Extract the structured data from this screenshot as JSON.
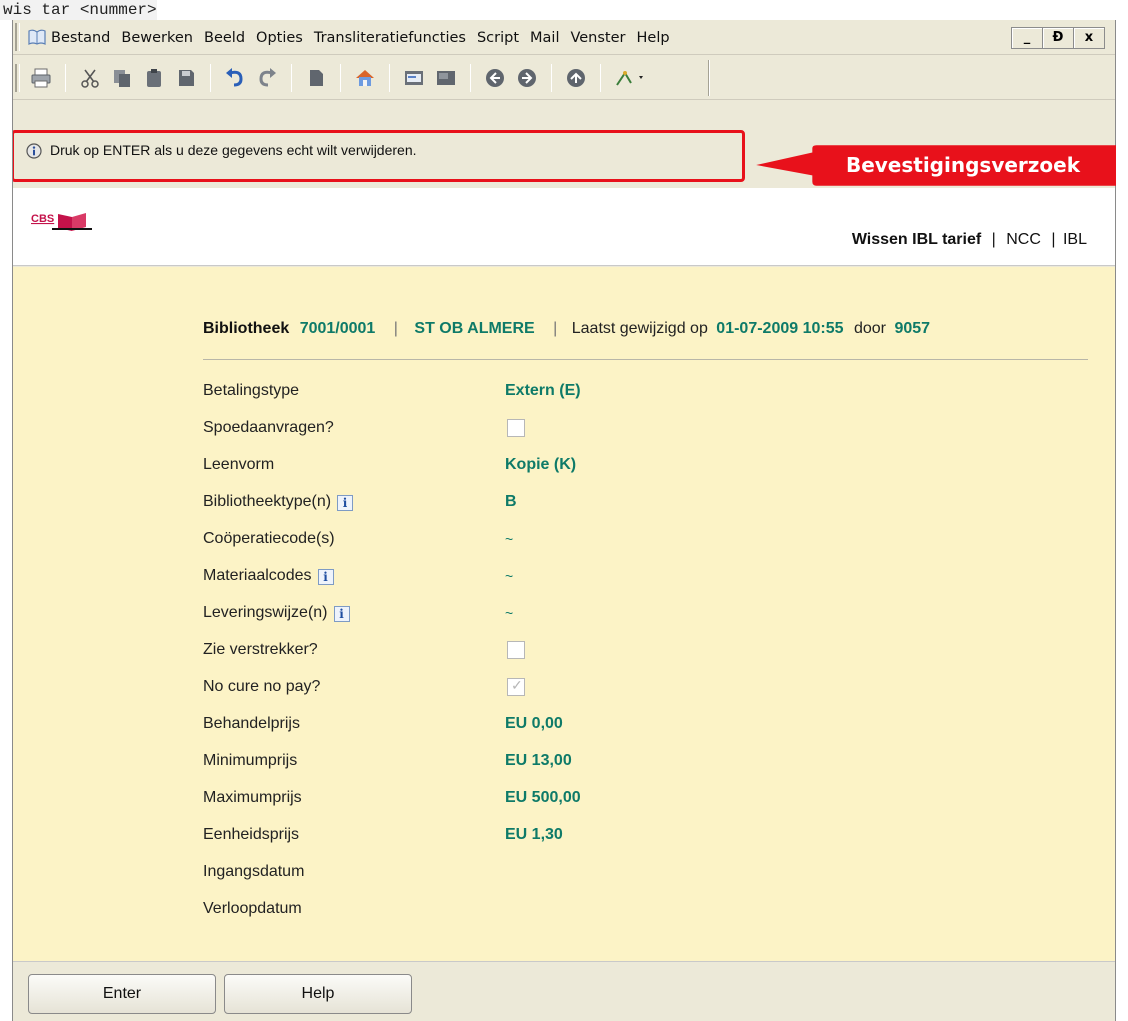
{
  "command_line": "wis tar <nummer>",
  "menubar": {
    "items": [
      "Bestand",
      "Bewerken",
      "Beeld",
      "Opties",
      "Transliteratiefuncties",
      "Script",
      "Mail",
      "Venster",
      "Help"
    ],
    "window_controls": [
      "_",
      "Ɖ",
      "x"
    ]
  },
  "toolbar": {
    "icons": [
      "print-icon",
      "cut-icon",
      "copy-icon",
      "paste-icon",
      "save-icon",
      "undo-icon",
      "redo-icon",
      "page-icon",
      "home-icon",
      "form-icon",
      "card-icon",
      "back-icon",
      "forward-icon",
      "up-icon",
      "tools-icon"
    ]
  },
  "message": {
    "text": "Druk op ENTER als u deze gegevens echt wilt verwijderen."
  },
  "callout": {
    "text": "Bevestigingsverzoek"
  },
  "header": {
    "logo_text": "CBS",
    "title": "Wissen IBL tarief",
    "sep1": "|",
    "tag1": "NCC",
    "sep2": "|",
    "tag2": "IBL"
  },
  "infobar": {
    "library_label": "Bibliotheek",
    "library_code": "7001/0001",
    "separator": "|",
    "library_name": "ST OB ALMERE",
    "modified_label": "Laatst gewijzigd op",
    "modified_date": "01-07-2009 10:55",
    "by_label": "door",
    "by_user": "9057"
  },
  "fields": {
    "betalingstype": {
      "label": "Betalingstype",
      "value": "Extern (E)"
    },
    "spoedaanvragen": {
      "label": "Spoedaanvragen?",
      "checked": false
    },
    "leenvorm": {
      "label": "Leenvorm",
      "value": "Kopie (K)"
    },
    "bibliotheektype": {
      "label": "Bibliotheektype(n)",
      "value": "B"
    },
    "cooperatiecode": {
      "label": "Coöperatiecode(s)",
      "value": "~"
    },
    "materiaalcodes": {
      "label": "Materiaalcodes",
      "value": "~"
    },
    "leveringswijze": {
      "label": "Leveringswijze(n)",
      "value": "~"
    },
    "zie_verstrekker": {
      "label": "Zie verstrekker?",
      "checked": false
    },
    "no_cure_no_pay": {
      "label": "No cure no pay?",
      "checked": true
    },
    "behandelprijs": {
      "label": "Behandelprijs",
      "value": "EU 0,00"
    },
    "minimumprijs": {
      "label": "Minimumprijs",
      "value": "EU 13,00"
    },
    "maximumprijs": {
      "label": "Maximumprijs",
      "value": "EU 500,00"
    },
    "eenheidsprijs": {
      "label": "Eenheidsprijs",
      "value": "EU 1,30"
    },
    "ingangsdatum": {
      "label": "Ingangsdatum",
      "value": ""
    },
    "verloopdatum": {
      "label": "Verloopdatum",
      "value": ""
    }
  },
  "info_icon_glyph": "i",
  "buttons": {
    "enter": "Enter",
    "help": "Help"
  },
  "colors": {
    "value_green": "#0e7a68",
    "highlight_red": "#e8111b",
    "content_bg": "#fcf3c6"
  }
}
